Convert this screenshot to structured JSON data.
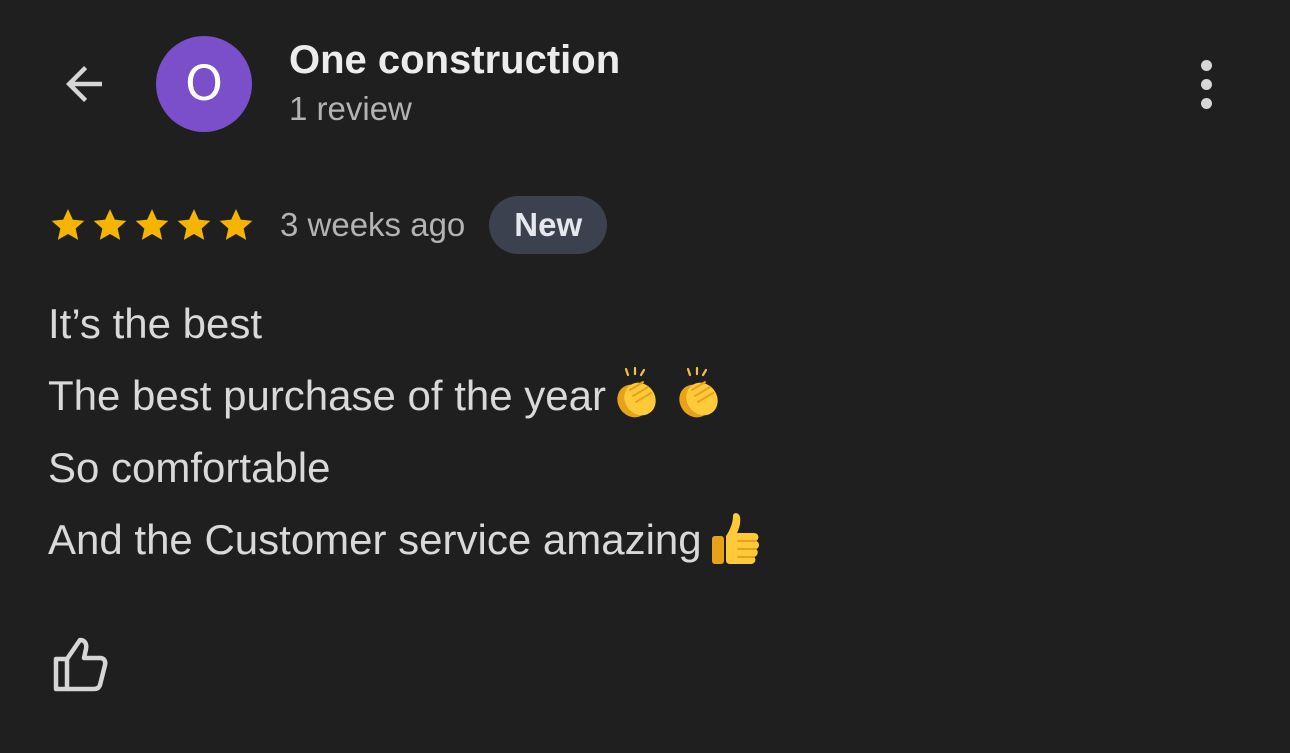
{
  "header": {
    "author_name": "One construction",
    "review_count": "1 review",
    "avatar_initial": "O",
    "avatar_color": "#7b4fc9"
  },
  "review": {
    "rating": 5,
    "rating_max": 5,
    "date": "3 weeks ago",
    "badge": "New",
    "lines": [
      "It’s the best",
      "The best purchase of the year",
      "So comfortable",
      "And the Customer service amazing"
    ]
  },
  "icons": {
    "back": "back-arrow-icon",
    "more": "more-vert-icon",
    "star": "star-icon",
    "clap": "clapping-hands-emoji",
    "thumbs_up_emoji": "thumbs-up-emoji",
    "like": "thumbs-up-outline-icon"
  },
  "colors": {
    "background": "#1f1f1f",
    "star": "#f5b400",
    "badge_bg": "#3c4150",
    "text": "#d9d9d9",
    "secondary_text": "#b3b3b3"
  }
}
